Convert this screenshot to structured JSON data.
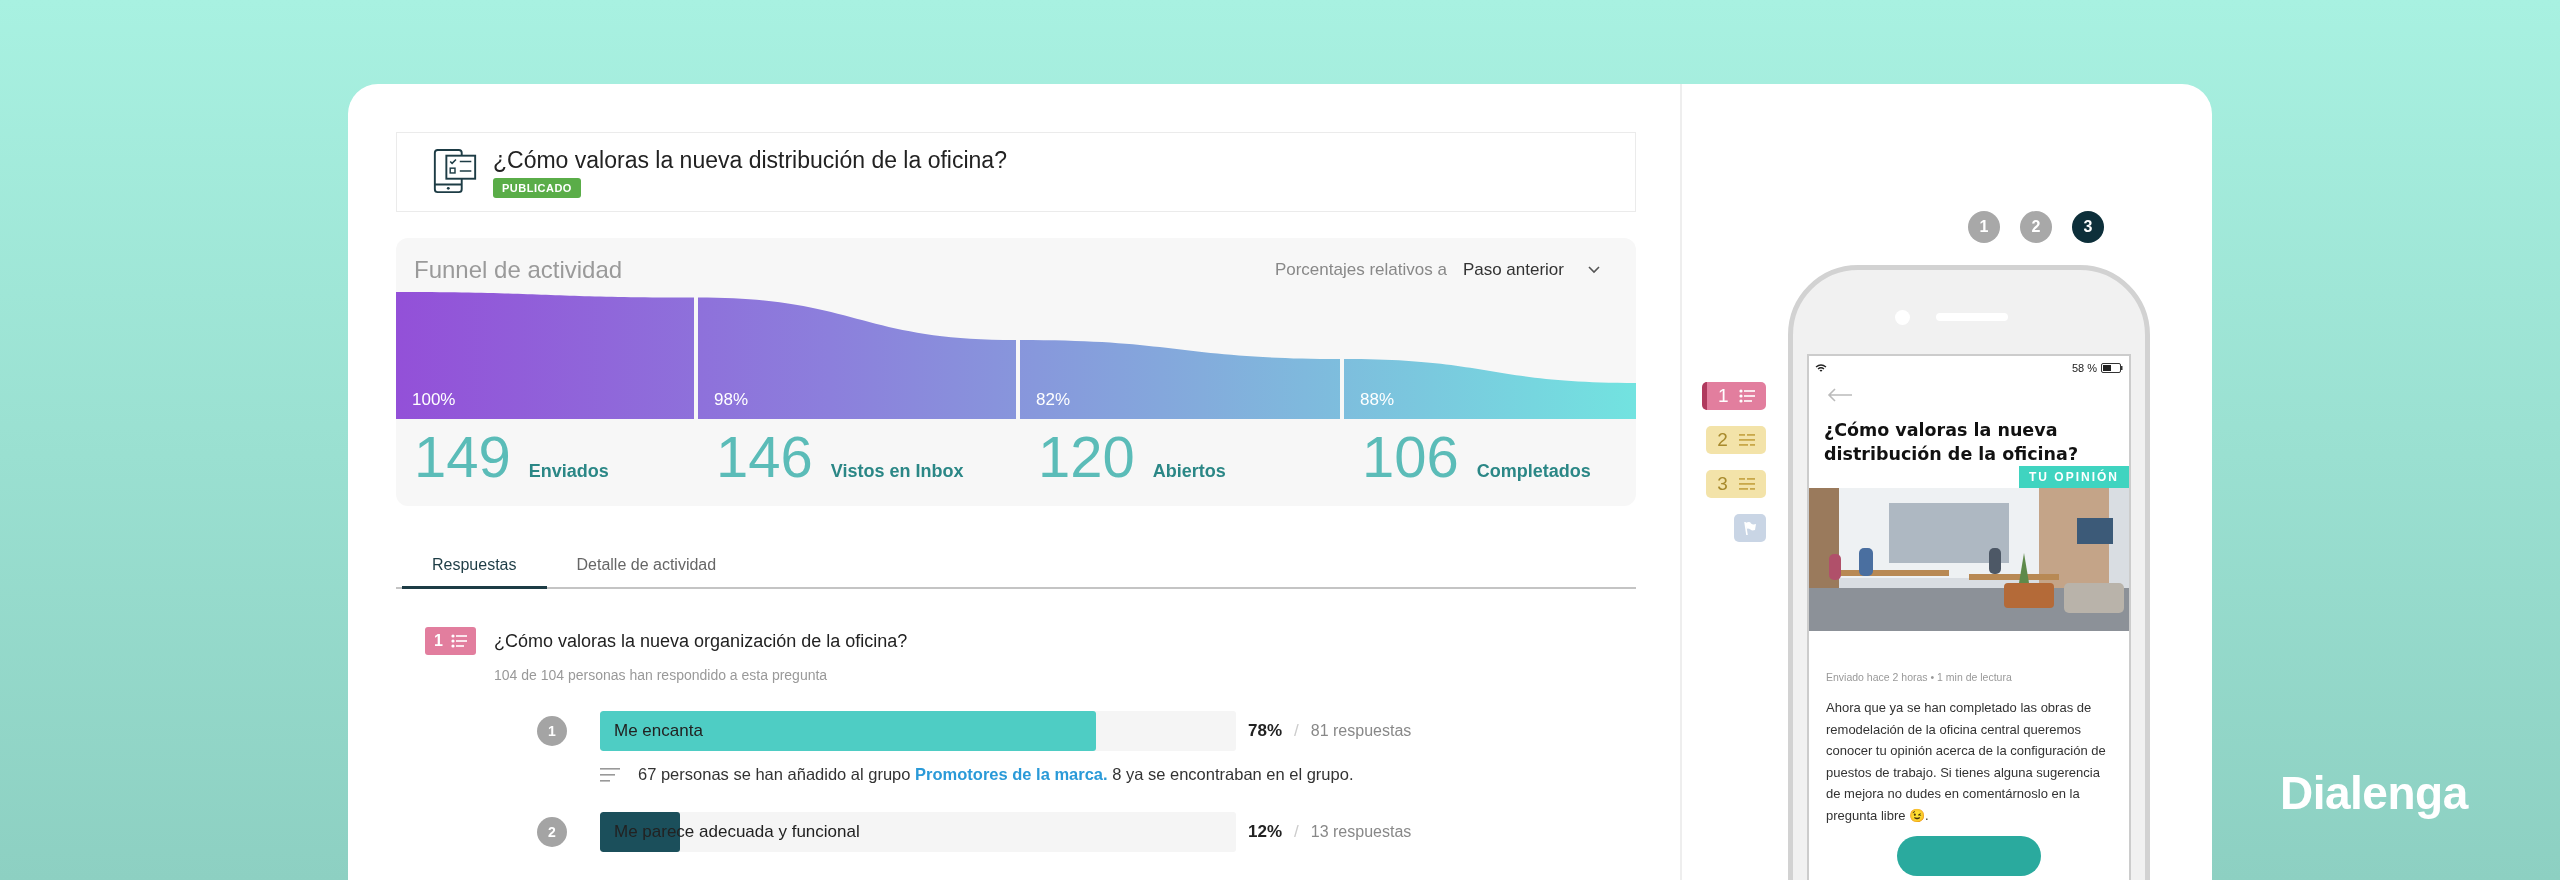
{
  "survey": {
    "title": "¿Cómo valoras la nueva distribución de la oficina?",
    "status": "PUBLICADO"
  },
  "funnel": {
    "title": "Funnel de actividad",
    "relative_label": "Porcentajes relativos a",
    "relative_value": "Paso anterior",
    "stages": [
      {
        "percent": "100%",
        "count": "149",
        "label": "Enviados"
      },
      {
        "percent": "98%",
        "count": "146",
        "label": "Vistos en Inbox"
      },
      {
        "percent": "82%",
        "count": "120",
        "label": "Abiertos"
      },
      {
        "percent": "88%",
        "count": "106",
        "label": "Completados"
      }
    ]
  },
  "tabs": [
    {
      "label": "Respuestas",
      "selected": true
    },
    {
      "label": "Detalle de actividad",
      "selected": false
    }
  ],
  "question": {
    "number": "1",
    "title": "¿Cómo valoras la nueva organización de la oficina?",
    "summary": "104 de 104 personas han respondido a esta pregunta",
    "options": [
      {
        "number": "1",
        "label": "Me encanta",
        "level": 0.78,
        "color": "#4ecdc4",
        "percent": "78%",
        "separator": "/",
        "responses": "81 respuestas",
        "note": {
          "before": "67 personas se han añadido al grupo ",
          "link": "Promotores de la marca.",
          "after": " 8 ya se encontraban en el grupo."
        }
      },
      {
        "number": "2",
        "label": "Me parece adecuada y funcional",
        "level": 0.125,
        "color": "#1b4f5b",
        "percent": "12%",
        "separator": "/",
        "responses": "13 respuestas"
      }
    ]
  },
  "preview": {
    "steps": [
      {
        "label": "1",
        "selected": false
      },
      {
        "label": "2",
        "selected": false
      },
      {
        "label": "3",
        "selected": true
      }
    ],
    "outline": [
      {
        "kind": "choice",
        "number": "1",
        "selected": true,
        "color": "#e27e9e"
      },
      {
        "kind": "text",
        "number": "2",
        "selected": false,
        "color": "#f3e3a9"
      },
      {
        "kind": "text",
        "number": "3",
        "selected": false,
        "color": "#f3e3a9"
      },
      {
        "kind": "end",
        "selected": false,
        "color": "#c9d5e5"
      }
    ],
    "phone": {
      "battery": "58 %",
      "title": "¿Cómo valoras la nueva distribución de la oficina?",
      "tag": "TU OPINIÓN",
      "meta": "Enviado hace 2 horas • 1 min de lectura",
      "body": "Ahora que ya se han completado las obras de remodelación de la oficina central queremos conocer tu opinión acerca de la configuración de puestos de trabajo. Si tienes alguna sugerencia de mejora no dudes en comentárnoslo en la pregunta libre 😉."
    }
  },
  "brand": "Dialenga"
}
